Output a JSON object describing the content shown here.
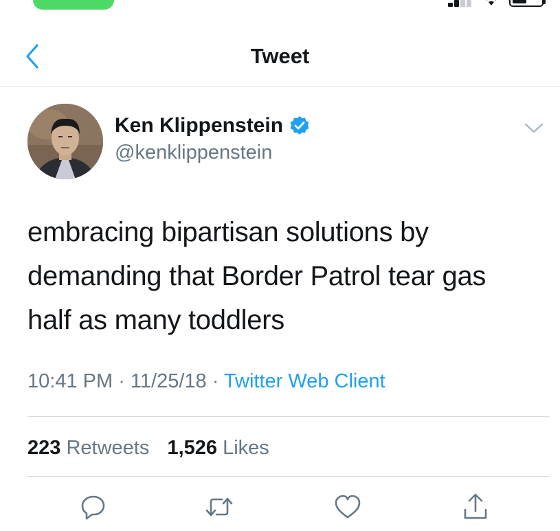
{
  "nav": {
    "title": "Tweet"
  },
  "icons": {
    "back": "chevron-left-icon",
    "verified": "verified-badge-icon",
    "more": "chevron-down-icon",
    "reply": "reply-icon",
    "retweet": "retweet-icon",
    "like": "heart-icon",
    "share": "share-icon"
  },
  "colors": {
    "accent": "#1da1f2",
    "text": "#14171a",
    "secondary": "#657786"
  },
  "tweet": {
    "author_name": "Ken Klippenstein",
    "author_handle": "@kenklippenstein",
    "verified": true,
    "lines": [
      "embracing bipartisan solutions by",
      "demanding that Border Patrol tear gas",
      "half as many toddlers"
    ],
    "time": "10:41 PM",
    "separator": " · ",
    "date": "11/25/18",
    "source": "Twitter Web Client",
    "retweets_count": "223",
    "retweets_label": "Retweets",
    "likes_count": "1,526",
    "likes_label": "Likes"
  }
}
